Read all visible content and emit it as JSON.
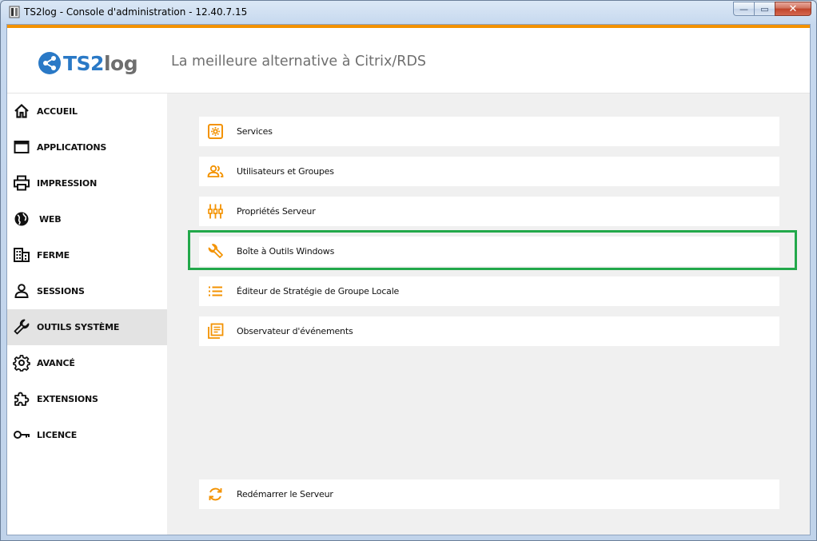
{
  "window": {
    "title": "TS2log - Console d'administration - 12.40.7.15",
    "min_glyph": "—",
    "max_glyph": "▭",
    "close_glyph": "✕"
  },
  "header": {
    "logo_ts2": "TS2",
    "logo_log": "log",
    "tagline": "La meilleure alternative à Citrix/RDS"
  },
  "colors": {
    "accent": "#f39200",
    "brand_blue": "#2a79c6",
    "highlight": "#22a84a",
    "active_nav": "#e3e3e3"
  },
  "sidebar": {
    "items": [
      {
        "label": "ACCUEIL",
        "icon": "home-icon"
      },
      {
        "label": "APPLICATIONS",
        "icon": "window-icon"
      },
      {
        "label": "IMPRESSION",
        "icon": "printer-icon"
      },
      {
        "label": "WEB",
        "icon": "globe-icon"
      },
      {
        "label": "FERME",
        "icon": "building-icon"
      },
      {
        "label": "SESSIONS",
        "icon": "user-icon"
      },
      {
        "label": "OUTILS SYSTÈME",
        "icon": "wrench-icon",
        "active": true
      },
      {
        "label": "AVANCÉ",
        "icon": "gear-icon"
      },
      {
        "label": "EXTENSIONS",
        "icon": "puzzle-icon"
      },
      {
        "label": "LICENCE",
        "icon": "key-icon"
      }
    ]
  },
  "main": {
    "tools": [
      {
        "label": "Services",
        "icon": "services-icon"
      },
      {
        "label": "Utilisateurs et Groupes",
        "icon": "users-icon"
      },
      {
        "label": "Propriétés Serveur",
        "icon": "sliders-icon"
      },
      {
        "label": "Boîte à Outils Windows",
        "icon": "wrench-icon",
        "highlighted": true
      },
      {
        "label": "Éditeur de Stratégie de Groupe Locale",
        "icon": "list-icon"
      },
      {
        "label": "Observateur d'événements",
        "icon": "event-log-icon"
      }
    ],
    "restart": {
      "label": "Redémarrer le Serveur",
      "icon": "refresh-icon"
    }
  }
}
